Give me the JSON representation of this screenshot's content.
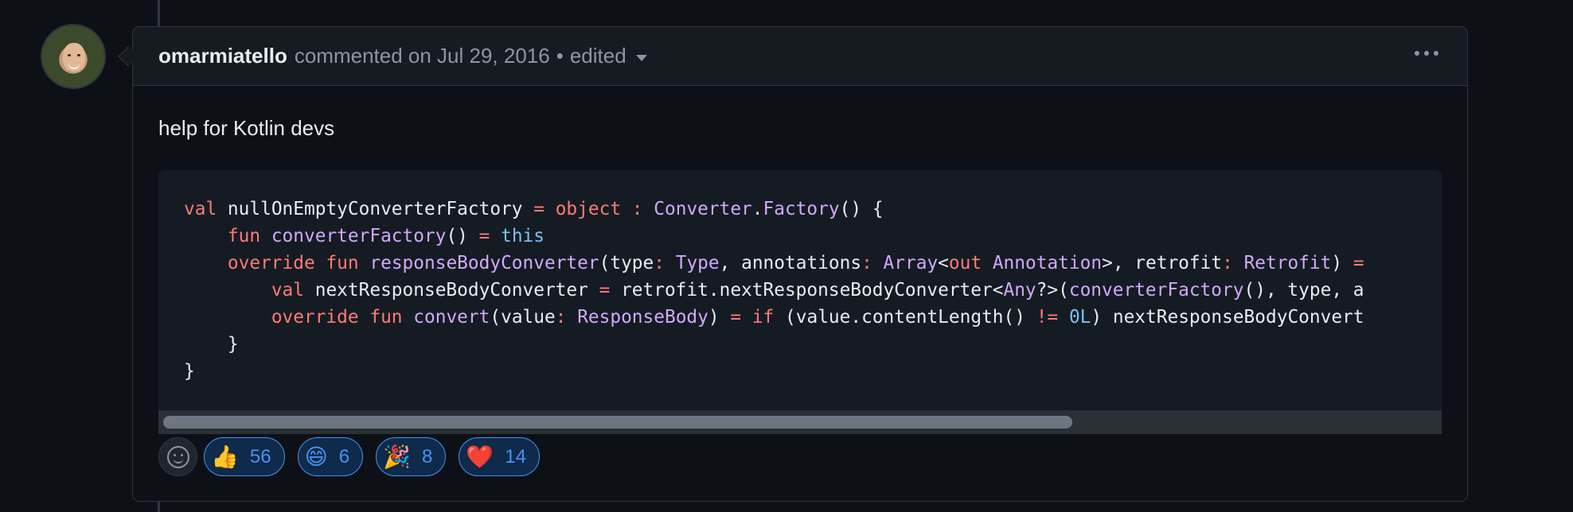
{
  "comment": {
    "author": "omarmiatello",
    "action_text": "commented on Jul 29, 2016",
    "separator": "•",
    "edited_label": "edited",
    "body_text": "help for Kotlin devs"
  },
  "code_lines": [
    "val nullOnEmptyConverterFactory = object : Converter.Factory() {",
    "    fun converterFactory() = this",
    "    override fun responseBodyConverter(type: Type, annotations: Array<out Annotation>, retrofit: Retrofit) =",
    "        val nextResponseBodyConverter = retrofit.nextResponseBodyConverter<Any?>(converterFactory(), type, a",
    "        override fun convert(value: ResponseBody) = if (value.contentLength() != 0L) nextResponseBodyConvert",
    "    }",
    "}"
  ],
  "reactions": [
    {
      "emoji": "👍",
      "icon_name": "thumbs-up-icon",
      "count": "56"
    },
    {
      "emoji": "😄",
      "icon_name": "grinning-face-icon",
      "count": "6"
    },
    {
      "emoji": "🎉",
      "icon_name": "party-popper-icon",
      "count": "8"
    },
    {
      "emoji": "❤️",
      "icon_name": "red-heart-icon",
      "count": "14"
    }
  ],
  "colors": {
    "background": "#0d1117",
    "header_bg": "#161b22",
    "border": "#30363d",
    "keyword": "#ff7b72",
    "function": "#d2a8ff",
    "constant": "#79c0ff",
    "accent": "#4493f8"
  }
}
